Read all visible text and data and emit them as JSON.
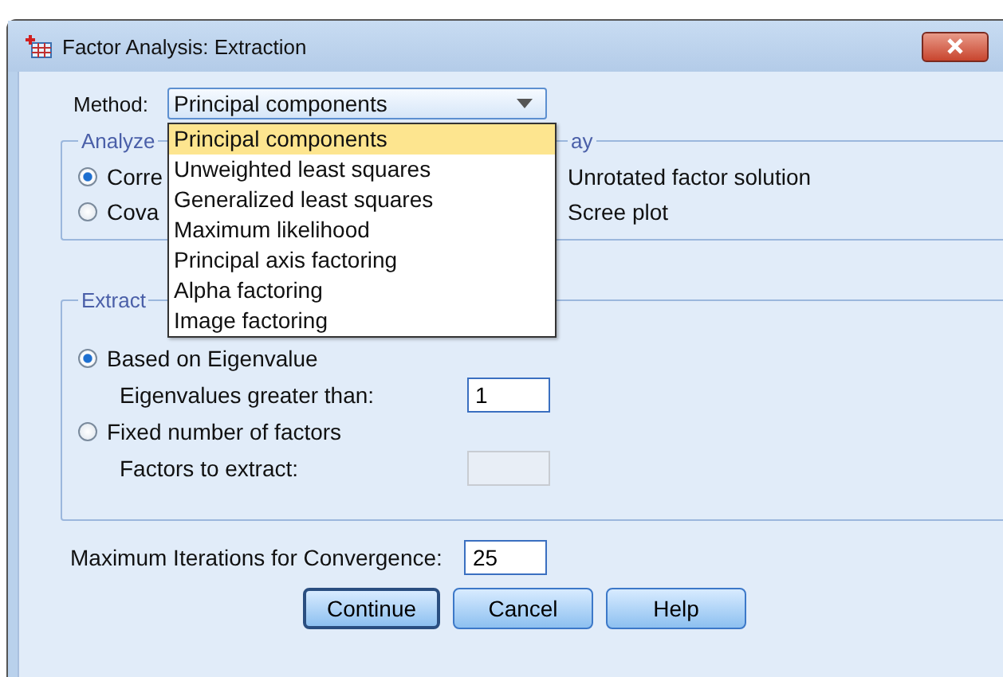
{
  "window": {
    "title": "Factor Analysis: Extraction"
  },
  "method": {
    "label": "Method:",
    "value": "Principal components",
    "expanded": true,
    "options": [
      {
        "label": "Principal components",
        "selected": true
      },
      {
        "label": "Unweighted least squares",
        "selected": false
      },
      {
        "label": "Generalized least squares",
        "selected": false
      },
      {
        "label": "Maximum likelihood",
        "selected": false
      },
      {
        "label": "Principal axis factoring",
        "selected": false
      },
      {
        "label": "Alpha factoring",
        "selected": false
      },
      {
        "label": "Image factoring",
        "selected": false
      }
    ]
  },
  "analyze": {
    "legend": "Analyze",
    "options": [
      {
        "label": "Corre",
        "selected": true
      },
      {
        "label": "Cova",
        "selected": false
      }
    ]
  },
  "display": {
    "legend": "ay",
    "options": [
      {
        "label": "Unrotated factor solution"
      },
      {
        "label": "Scree plot"
      }
    ]
  },
  "extract": {
    "legend": "Extract",
    "options": [
      {
        "label": "Based on Eigenvalue",
        "selected": true,
        "field_label": "Eigenvalues greater than:",
        "value": "1",
        "disabled": false
      },
      {
        "label": "Fixed number of factors",
        "selected": false,
        "field_label": "Factors to extract:",
        "disabled": true
      }
    ]
  },
  "max_iterations": {
    "label": "Maximum Iterations for Convergence:",
    "value": "25"
  },
  "buttons": [
    {
      "label": "Continue",
      "default": true
    },
    {
      "label": "Cancel",
      "default": false
    },
    {
      "label": "Help",
      "default": false
    }
  ]
}
